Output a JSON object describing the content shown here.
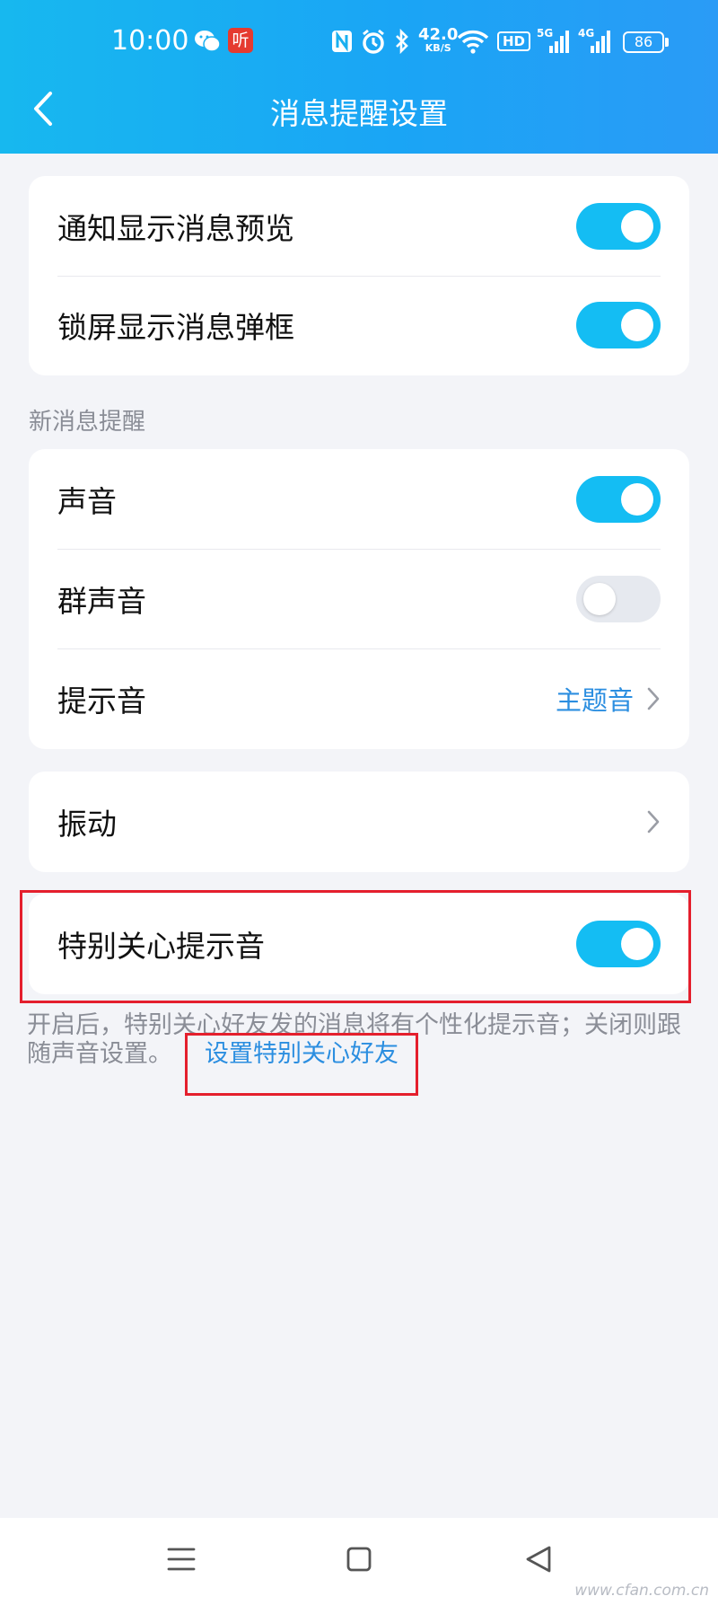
{
  "status_bar": {
    "time": "10:00",
    "app_badge": "听",
    "net_speed_value": "42.0",
    "net_speed_unit": "KB/S",
    "hd_label": "HD",
    "signal1_label": "5G",
    "signal2_label": "4G",
    "battery": "86"
  },
  "header": {
    "title": "消息提醒设置"
  },
  "card1": {
    "rows": [
      {
        "label": "通知显示消息预览",
        "toggle_on": true
      },
      {
        "label": "锁屏显示消息弹框",
        "toggle_on": true
      }
    ]
  },
  "section_new_message": {
    "title": "新消息提醒",
    "rows": [
      {
        "label": "声音",
        "toggle_on": true
      },
      {
        "label": "群声音",
        "toggle_on": false
      },
      {
        "label": "提示音",
        "value": "主题音"
      }
    ]
  },
  "vibration": {
    "label": "振动"
  },
  "special_care": {
    "label": "特别关心提示音",
    "toggle_on": true,
    "description": "开启后，特别关心好友发的消息将有个性化提示音；关闭则跟随声音设置。",
    "link_text": "设置特别关心好友"
  },
  "watermark": "www.cfan.com.cn",
  "colors": {
    "accent": "#14bdf3",
    "link": "#2b8ee0",
    "highlight": "#e41f2d",
    "background": "#f3f4f8"
  }
}
